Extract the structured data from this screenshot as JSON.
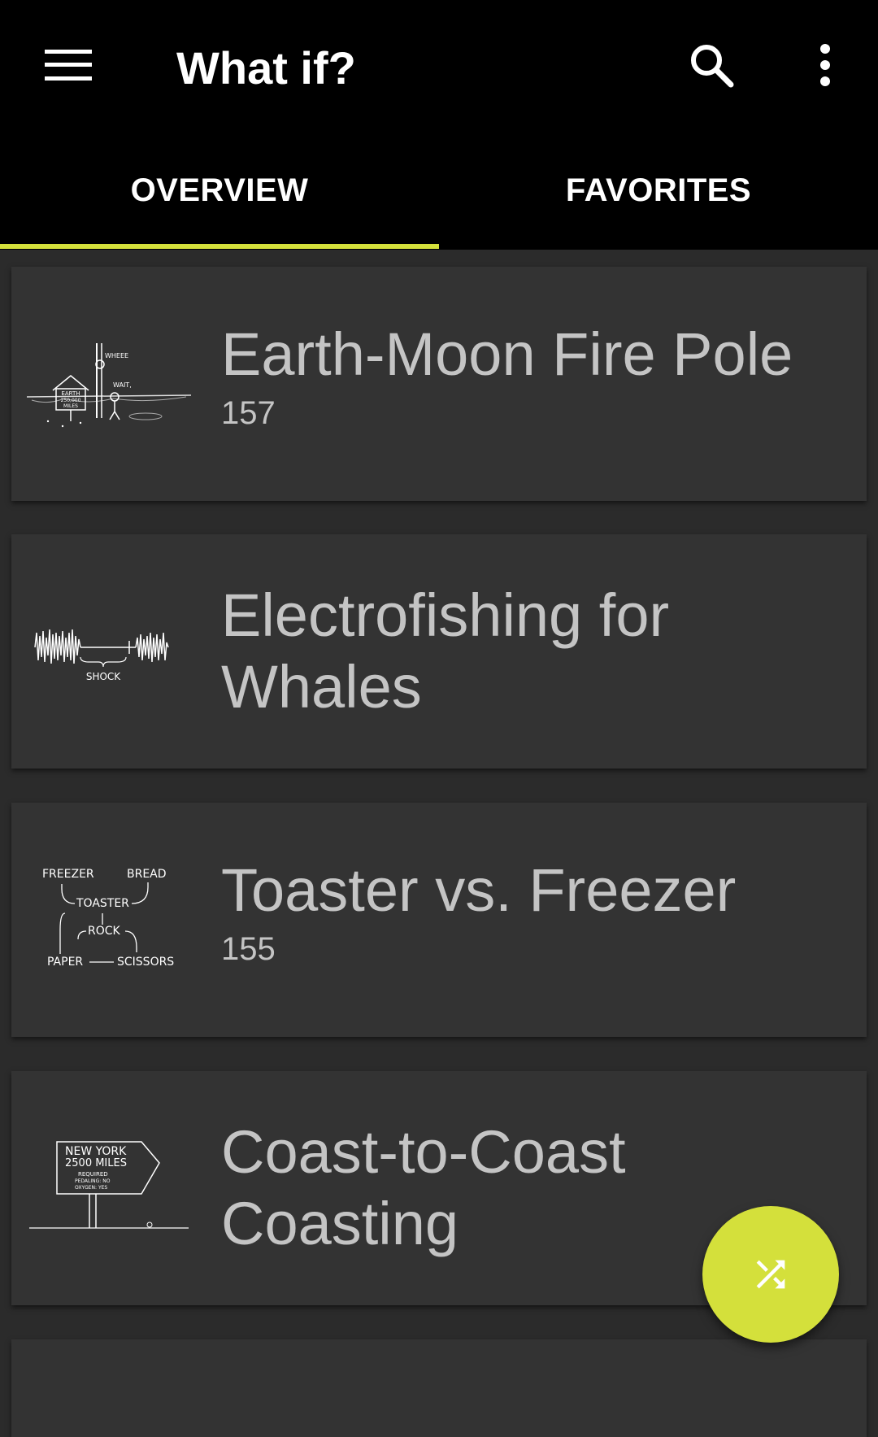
{
  "app": {
    "title": "What if?"
  },
  "tabs": [
    {
      "label": "OVERVIEW",
      "selected": true
    },
    {
      "label": "FAVORITES",
      "selected": false
    }
  ],
  "colors": {
    "accent": "#d4e03b",
    "appbar": "#000000",
    "card": "#333333",
    "background": "#2b2b2b"
  },
  "icons": {
    "menu": "hamburger-icon",
    "search": "search-icon",
    "more": "more-vert-icon",
    "fab": "shuffle-icon"
  },
  "articles": [
    {
      "title": "Earth-Moon Fire Pole",
      "number": "157",
      "thumb_text": {
        "sign1": "EARTH",
        "sign2": "250,000",
        "sign3": "MILES",
        "shout": "WHEEE",
        "reply": "WAIT,"
      }
    },
    {
      "title": "Electrofishing for Whales",
      "number": "",
      "thumb_text": {
        "label": "SHOCK"
      }
    },
    {
      "title": "Toaster vs. Freezer",
      "number": "155",
      "thumb_text": {
        "a": "FREEZER",
        "b": "BREAD",
        "c": "TOASTER",
        "d": "ROCK",
        "e": "PAPER",
        "f": "SCISSORS"
      }
    },
    {
      "title": "Coast-to-Coast Coasting",
      "number": "",
      "thumb_text": {
        "line1": "NEW YORK",
        "line2": "2500 MILES",
        "line3": "REQUIRED",
        "line4": "PEDALING: NO",
        "line5": "OXYGEN: YES"
      }
    }
  ]
}
